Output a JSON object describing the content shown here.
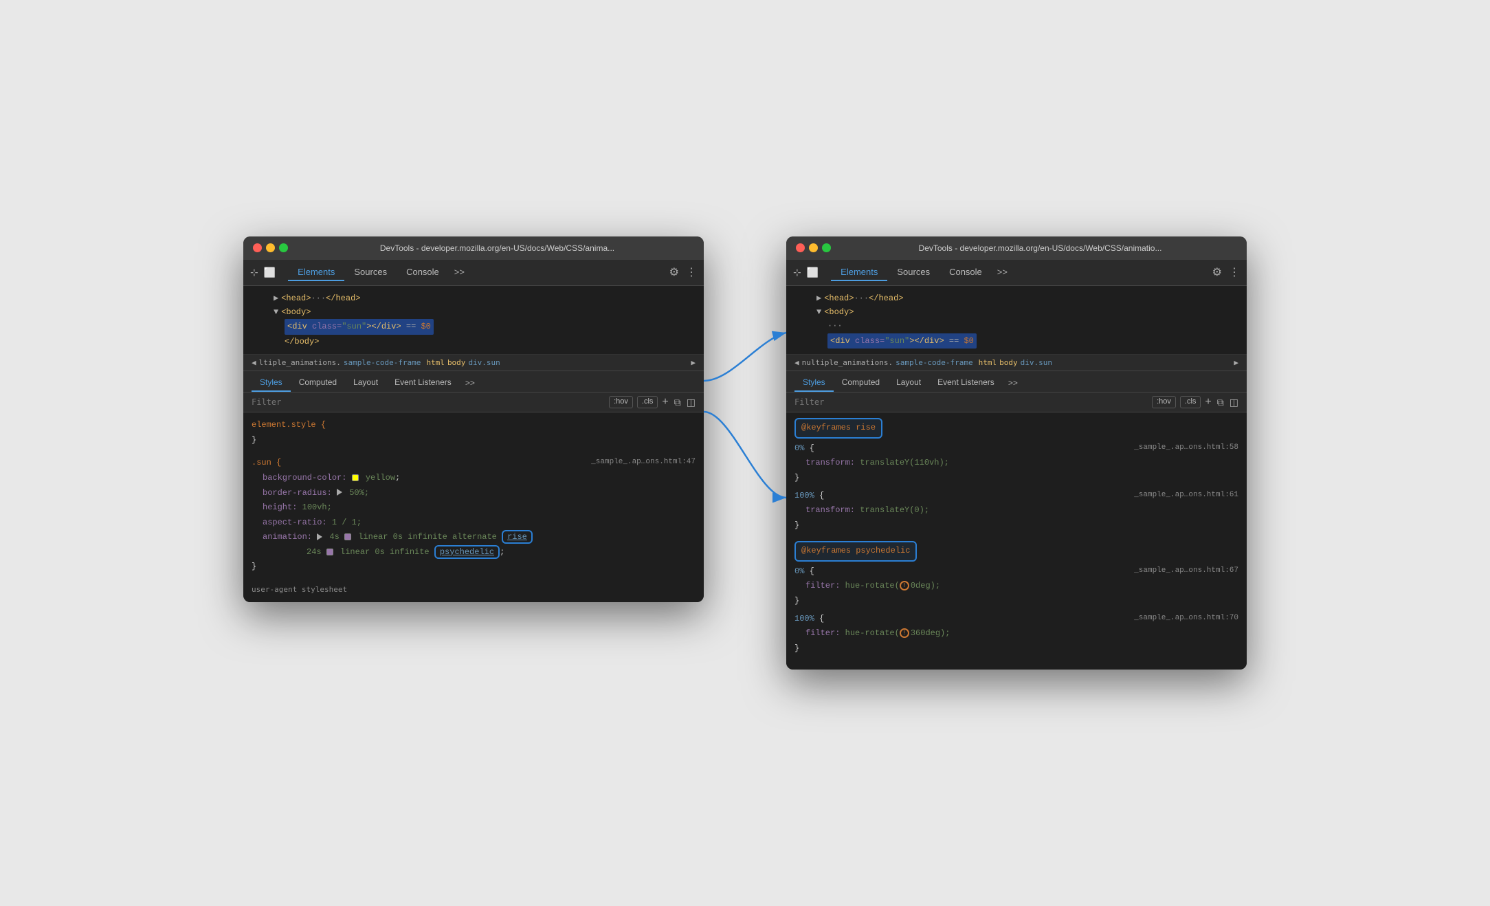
{
  "left_window": {
    "title": "DevTools - developer.mozilla.org/en-US/docs/Web/CSS/anima...",
    "tabs": [
      "Elements",
      "Sources",
      "Console"
    ],
    "active_tab": "Elements",
    "dom": {
      "lines": [
        {
          "indent": 2,
          "content": "▶ <head> ··· </head>",
          "type": "collapsed"
        },
        {
          "indent": 2,
          "content": "▼ <body>",
          "type": "open"
        },
        {
          "indent": 3,
          "content": "<div class=\"sun\"></div> == $0",
          "type": "selected"
        },
        {
          "indent": 3,
          "content": "</body>",
          "type": "close"
        }
      ]
    },
    "breadcrumb": {
      "prefix": "◀",
      "items": [
        "ltiple_animations.",
        "sample-code-frame",
        "html",
        "body",
        "div.sun"
      ],
      "suffix": "▶"
    },
    "sub_tabs": [
      "Styles",
      "Computed",
      "Layout",
      "Event Listeners"
    ],
    "filter_placeholder": "Filter",
    "filter_badges": [
      ":hov",
      ".cls"
    ],
    "css_rules": [
      {
        "selector": "element.style {",
        "close": "}",
        "props": []
      },
      {
        "selector": ".sun {",
        "source": "_sample_.ap…ons.html:47",
        "close": "}",
        "props": [
          {
            "name": "background-color:",
            "value": "yellow",
            "swatch": "#ffff00"
          },
          {
            "name": "border-radius:",
            "value": "▶ 50%;"
          },
          {
            "name": "height:",
            "value": "100vh;"
          },
          {
            "name": "aspect-ratio:",
            "value": "1 / 1;"
          },
          {
            "name": "animation:",
            "value": "▶ 4s ■ linear 0s infinite alternate",
            "link": "rise",
            "annotated": true
          },
          {
            "indent": true,
            "value": "24s ■ linear 0s infinite",
            "link": "psychedelic",
            "annotated": true,
            "suffix": ";"
          }
        ]
      }
    ]
  },
  "right_window": {
    "title": "DevTools - developer.mozilla.org/en-US/docs/Web/CSS/animatio...",
    "tabs": [
      "Elements",
      "Sources",
      "Console"
    ],
    "active_tab": "Elements",
    "dom": {
      "lines": [
        {
          "indent": 2,
          "content": "▶ <head> ··· </head>",
          "type": "collapsed"
        },
        {
          "indent": 2,
          "content": "▼ <body>",
          "type": "open"
        },
        {
          "indent": 3,
          "content": "···",
          "type": "dots"
        },
        {
          "indent": 3,
          "content": "<div class=\"sun\"></div> == $0",
          "type": "selected"
        }
      ]
    },
    "breadcrumb": {
      "prefix": "◀",
      "items": [
        "nultiple_animations.",
        "sample-code-frame",
        "html",
        "body",
        "div.sun"
      ],
      "suffix": "▶"
    },
    "sub_tabs": [
      "Styles",
      "Computed",
      "Layout",
      "Event Listeners"
    ],
    "filter_placeholder": "Filter",
    "filter_badges": [
      ":hov",
      ".cls"
    ],
    "css_rules": [
      {
        "at_rule": "@keyframes rise",
        "annotated": true,
        "entries": [
          {
            "pct": "0% {",
            "source": "_sample_.ap…ons.html:58",
            "props": [
              {
                "name": "transform:",
                "value": "translateY(110vh);"
              }
            ],
            "close": "}"
          },
          {
            "pct": "100% {",
            "source": "_sample_.ap…ons.html:61",
            "props": [
              {
                "name": "transform:",
                "value": "translateY(0);"
              }
            ],
            "close": "}"
          }
        ]
      },
      {
        "at_rule": "@keyframes psychedelic",
        "annotated": true,
        "entries": [
          {
            "pct": "0% {",
            "source": "_sample_.ap…ons.html:67",
            "props": [
              {
                "name": "filter:",
                "value": "hue-rotate(⓪0deg);"
              }
            ],
            "close": "}"
          },
          {
            "pct": "100% {",
            "source": "_sample_.ap…ons.html:70",
            "props": [
              {
                "name": "filter:",
                "value": "hue-rotate(⓪360deg);"
              }
            ],
            "close": "}"
          }
        ]
      }
    ]
  },
  "arrows": {
    "from_rise": "rise annotation to @keyframes rise",
    "from_psychedelic": "psychedelic annotation to @keyframes psychedelic"
  }
}
